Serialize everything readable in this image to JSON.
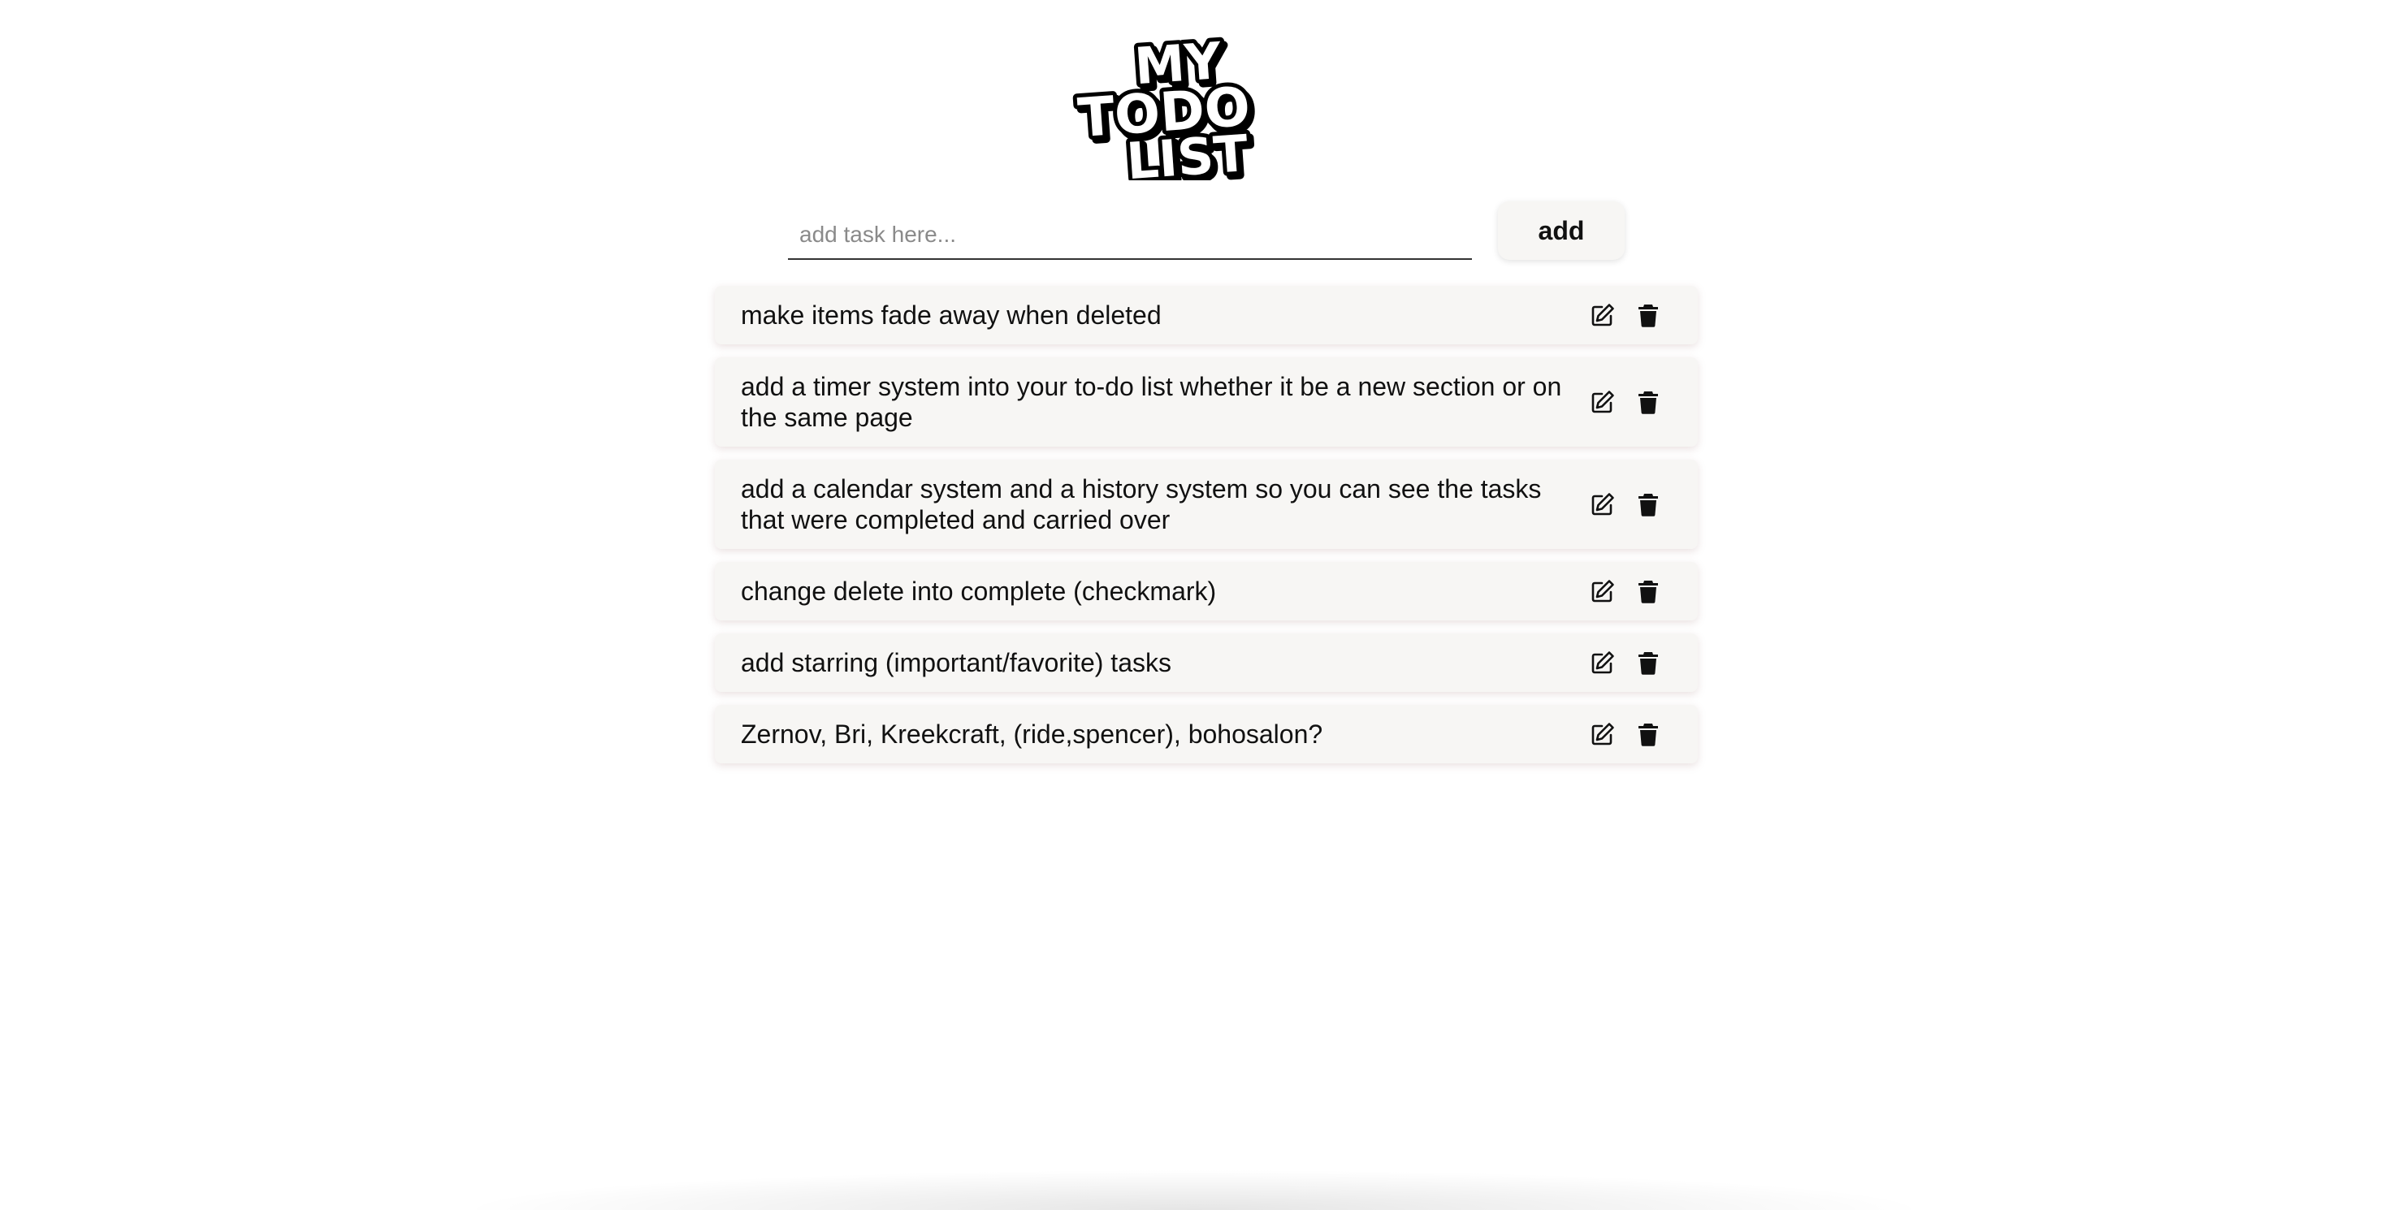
{
  "logo": {
    "line1": "MY",
    "line2": "TODO",
    "line3": "LIST"
  },
  "input": {
    "placeholder": "add task here...",
    "value": ""
  },
  "add_button": {
    "label": "add"
  },
  "icons": {
    "edit": "edit-icon",
    "delete": "trash-icon"
  },
  "tasks": [
    {
      "text": "make items fade away when deleted"
    },
    {
      "text": "add a timer system into your to-do list whether it be a new section or on the same page"
    },
    {
      "text": "add a calendar system and a history system so you can see the tasks that were completed and carried over"
    },
    {
      "text": "change delete into complete (checkmark)"
    },
    {
      "text": "add starring (important/favorite) tasks"
    },
    {
      "text": "Zernov, Bri, Kreekcraft, (ride,spencer), bohosalon?"
    }
  ]
}
